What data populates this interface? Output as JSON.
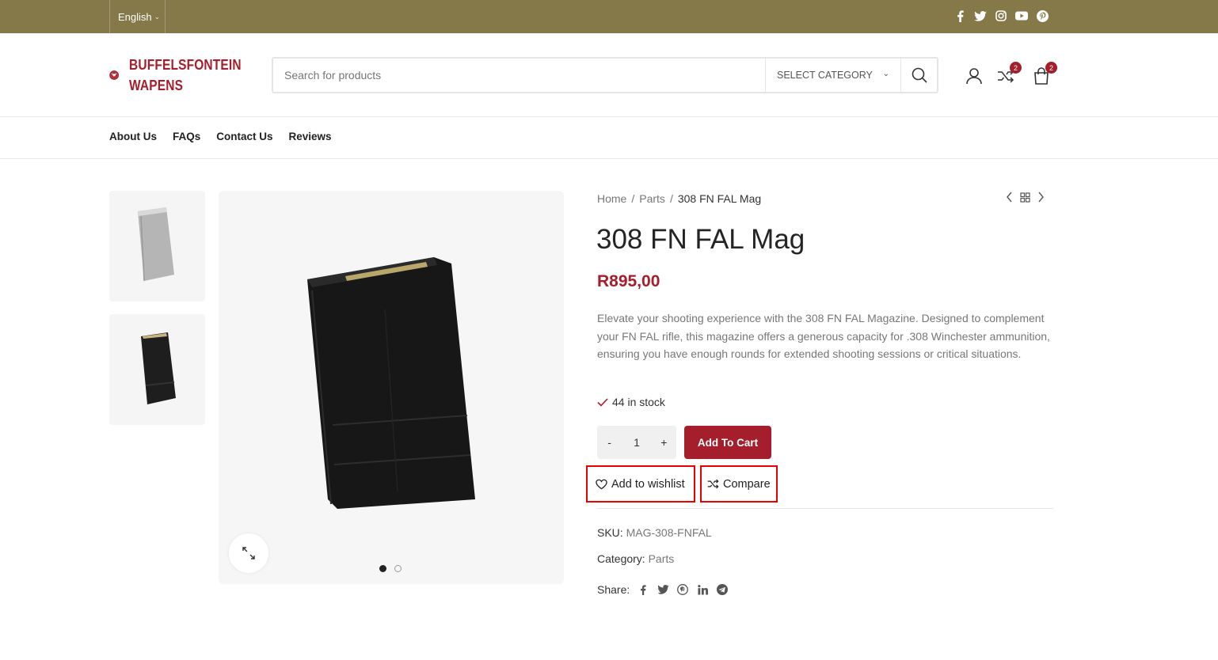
{
  "topbar": {
    "language": "English",
    "socials": [
      "facebook-icon",
      "twitter-icon",
      "instagram-icon",
      "youtube-icon",
      "pinterest-icon"
    ]
  },
  "header": {
    "logo_line1": "BUFFELSFONTEIN",
    "logo_line2": "WAPENS",
    "search_placeholder": "Search for products",
    "category_label": "SELECT CATEGORY",
    "compare_count": "2",
    "cart_count": "2"
  },
  "nav": {
    "items": [
      "About Us",
      "FAQs",
      "Contact Us",
      "Reviews"
    ]
  },
  "breadcrumb": {
    "home": "Home",
    "sep": "/",
    "parent": "Parts",
    "current": "308 FN FAL Mag"
  },
  "product": {
    "title": "308 FN FAL Mag",
    "price": "R895,00",
    "description": "Elevate your shooting experience with the 308 FN FAL Magazine. Designed to complement your FN FAL rifle, this magazine offers a generous capacity for .308 Winchester ammunition, ensuring you have enough rounds for extended shooting sessions or critical situations.",
    "stock": "44 in stock",
    "qty_minus": "-",
    "qty_value": "1",
    "qty_plus": "+",
    "add_to_cart": "Add To Cart",
    "wishlist": "Add to wishlist",
    "compare": "Compare",
    "sku_label": "SKU:",
    "sku": "MAG-308-FNFAL",
    "category_label": "Category:",
    "category": "Parts",
    "share_label": "Share:"
  },
  "colors": {
    "topbar": "#857849",
    "brand": "#a41e2b",
    "highlight": "#e00000"
  }
}
